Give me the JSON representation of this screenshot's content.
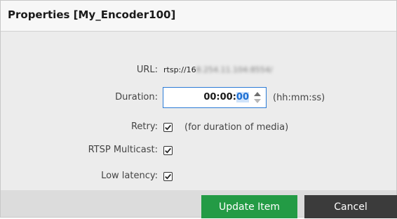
{
  "dialog": {
    "title": "Properties [My_Encoder100]"
  },
  "fields": {
    "url": {
      "label": "URL:",
      "value_prefix": "rtsp://16",
      "value_obscured": "8.254.11.104:8554/"
    },
    "duration": {
      "label": "Duration:",
      "value_unselected": "00:00:",
      "value_selected": "00",
      "hint": "(hh:mm:ss)"
    },
    "retry": {
      "label": "Retry:",
      "checked": true,
      "hint": "(for duration of media)"
    },
    "rtsp_multicast": {
      "label": "RTSP Multicast:",
      "checked": true
    },
    "low_latency": {
      "label": "Low latency:",
      "checked": true
    }
  },
  "buttons": {
    "update": "Update Item",
    "cancel": "Cancel"
  },
  "colors": {
    "update_button": "#239b45",
    "cancel_button": "#3b3b3b",
    "focus_border": "#2b7bd6"
  }
}
